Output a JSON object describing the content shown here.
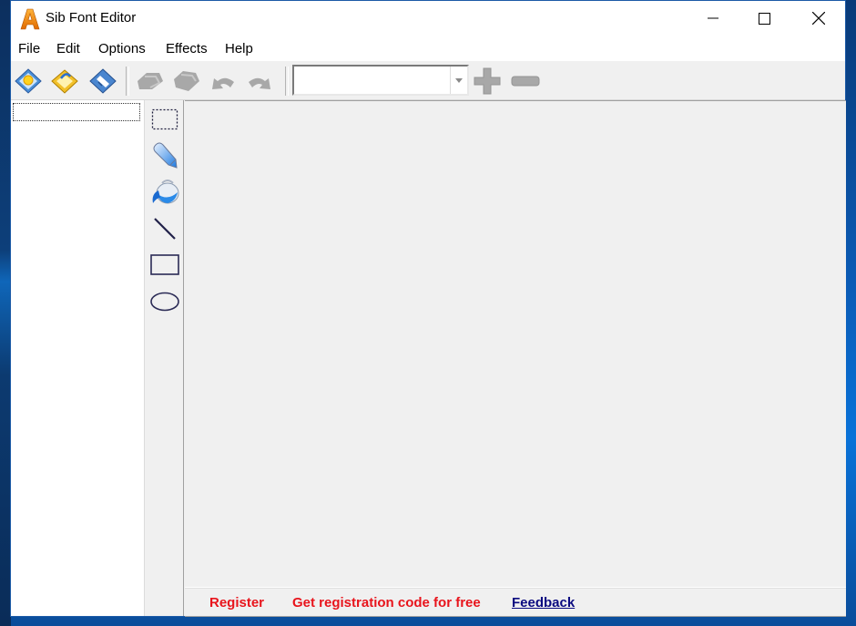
{
  "window": {
    "title": "Sib Font Editor",
    "controls": {
      "minimize": "minimize",
      "maximize": "maximize",
      "close": "close"
    }
  },
  "menubar": {
    "items": [
      {
        "label": "File"
      },
      {
        "label": "Edit"
      },
      {
        "label": "Options"
      },
      {
        "label": "Effects"
      },
      {
        "label": "Help"
      }
    ]
  },
  "toolbar": {
    "buttons": [
      {
        "icon": "new-file-icon",
        "enabled": true
      },
      {
        "icon": "open-folder-icon",
        "enabled": true
      },
      {
        "icon": "save-disk-icon",
        "enabled": true
      },
      {
        "icon": "copy-icon",
        "enabled": false
      },
      {
        "icon": "paste-icon",
        "enabled": false
      },
      {
        "icon": "undo-icon",
        "enabled": false
      },
      {
        "icon": "redo-icon",
        "enabled": false
      }
    ],
    "combo": {
      "value": "",
      "placeholder": ""
    },
    "zoom_in": {
      "icon": "plus-icon",
      "enabled": false
    },
    "zoom_out": {
      "icon": "minus-icon",
      "enabled": false
    }
  },
  "tools": [
    {
      "name": "select",
      "icon": "select-rect-icon"
    },
    {
      "name": "pencil",
      "icon": "pencil-icon"
    },
    {
      "name": "fill",
      "icon": "paint-bucket-icon"
    },
    {
      "name": "line",
      "icon": "line-icon"
    },
    {
      "name": "rectangle",
      "icon": "rectangle-icon"
    },
    {
      "name": "ellipse",
      "icon": "ellipse-icon"
    }
  ],
  "statusbar": {
    "register": "Register",
    "get_code": "Get registration code for free",
    "feedback": "Feedback",
    "colors": {
      "red": "#e8141c",
      "link": "#0a0a80"
    }
  }
}
